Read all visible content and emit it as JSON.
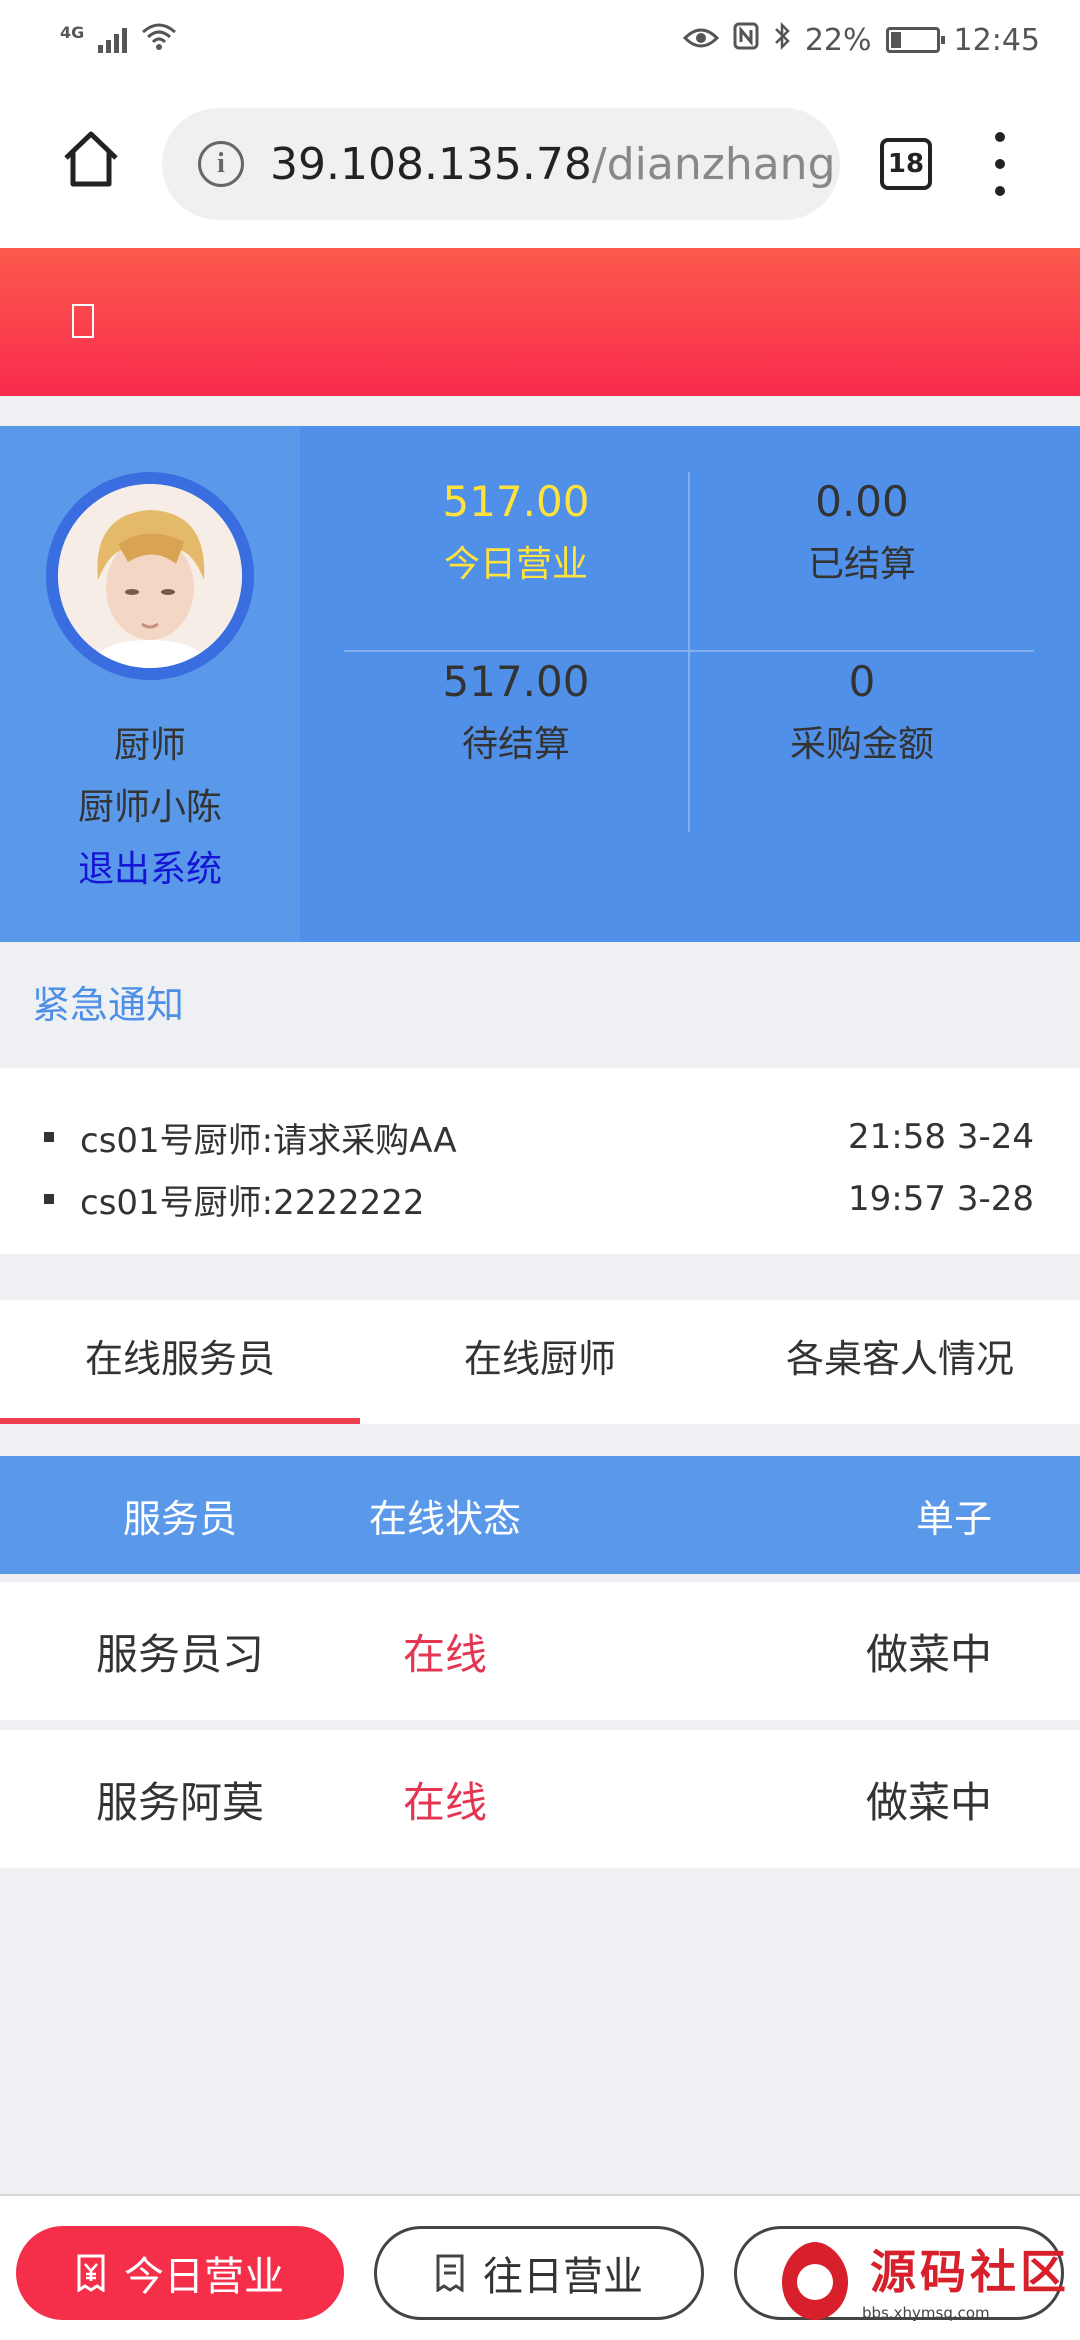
{
  "status_bar": {
    "network": "4G",
    "battery": "22%",
    "time": "12:45"
  },
  "browser": {
    "url_host": "39.108.135.78",
    "url_path": "/dianzhang",
    "tab_count": "18"
  },
  "profile": {
    "role": "厨师",
    "name": "厨师小陈",
    "logout": "退出系统"
  },
  "stats": [
    {
      "value": "517.00",
      "label": "今日营业"
    },
    {
      "value": "0.00",
      "label": "已结算"
    },
    {
      "value": "517.00",
      "label": "待结算"
    },
    {
      "value": "0",
      "label": "采购金额"
    }
  ],
  "notice": {
    "title": "紧急通知",
    "items": [
      {
        "text": "cs01号厨师:请求采购AA",
        "time": "21:58 3-24"
      },
      {
        "text": "cs01号厨师:2222222",
        "time": "19:57 3-28"
      }
    ]
  },
  "tabs": [
    "在线服务员",
    "在线厨师",
    "各桌客人情况"
  ],
  "table": {
    "headers": [
      "服务员",
      "在线状态",
      "单子"
    ],
    "rows": [
      [
        "服务员习",
        "在线",
        "做菜中"
      ],
      [
        "服务阿莫",
        "在线",
        "做菜中"
      ]
    ]
  },
  "bottom_nav": {
    "today": "今日营业",
    "past": "往日营业"
  },
  "watermark": {
    "text": "源码社区",
    "sub": "bbs.xhymsq.com"
  },
  "colors": {
    "header_red": "#f92b4d",
    "panel_blue": "#5190e8",
    "highlight_yellow": "#ffe23b",
    "online_red": "#e33652"
  }
}
